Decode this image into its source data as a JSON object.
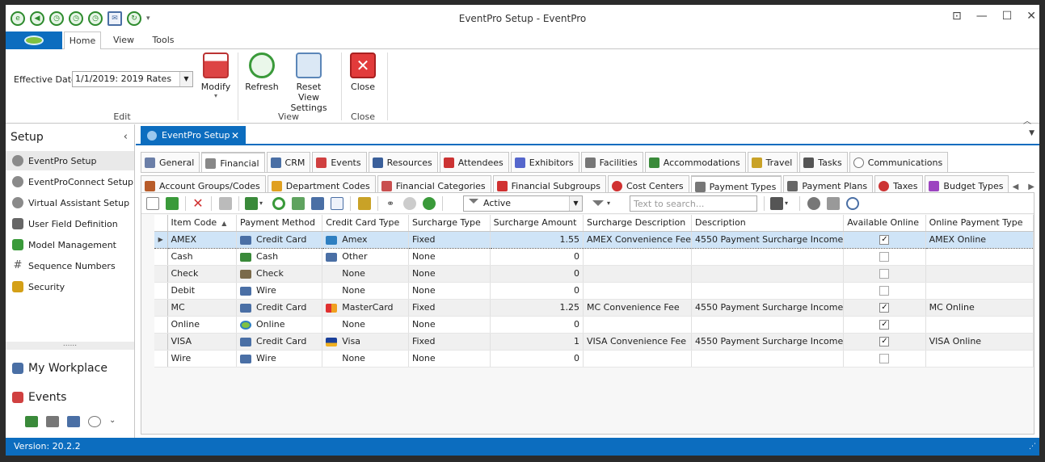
{
  "window": {
    "title": "EventPro Setup - EventPro"
  },
  "ribbon": {
    "tabs": [
      "Home",
      "View",
      "Tools"
    ],
    "effective_date_label": "Effective Date",
    "effective_date_value": "1/1/2019: 2019 Rates",
    "modify_label": "Modify",
    "refresh_label": "Refresh",
    "reset_label_1": "Reset View",
    "reset_label_2": "Settings",
    "close_label": "Close",
    "groups": [
      "Edit",
      "View",
      "Close"
    ]
  },
  "sidebar": {
    "title": "Setup",
    "items": [
      {
        "label": "EventPro Setup",
        "icon": "gears-icon",
        "color": "#7a7a7a"
      },
      {
        "label": "EventProConnect Setup",
        "icon": "gears-icon",
        "color": "#7a7a7a"
      },
      {
        "label": "Virtual Assistant Setup",
        "icon": "gears-icon",
        "color": "#7a7a7a"
      },
      {
        "label": "User Field Definition",
        "icon": "user-icon",
        "color": "#555555"
      },
      {
        "label": "Model Management",
        "icon": "model-icon",
        "color": "#3a9a3a"
      },
      {
        "label": "Sequence Numbers",
        "icon": "hash-icon",
        "color": "#555555"
      },
      {
        "label": "Security",
        "icon": "lock-icon",
        "color": "#d4a017"
      }
    ],
    "workplace_label": "My Workplace",
    "events_label": "Events"
  },
  "document_tab": {
    "label": "EventPro Setup",
    "close": "✕"
  },
  "main_tabs": [
    {
      "label": "General",
      "color": "#6b7fa8"
    },
    {
      "label": "Financial",
      "color": "#888888"
    },
    {
      "label": "CRM",
      "color": "#4a6fa5"
    },
    {
      "label": "Events",
      "color": "#d04040"
    },
    {
      "label": "Resources",
      "color": "#3a5f9a"
    },
    {
      "label": "Attendees",
      "color": "#cc3333"
    },
    {
      "label": "Exhibitors",
      "color": "#5566cc"
    },
    {
      "label": "Facilities",
      "color": "#777777"
    },
    {
      "label": "Accommodations",
      "color": "#3a8a3a"
    },
    {
      "label": "Travel",
      "color": "#c9a227"
    },
    {
      "label": "Tasks",
      "color": "#555555"
    },
    {
      "label": "Communications",
      "color": "#888888"
    }
  ],
  "sub_tabs": [
    {
      "label": "Account Groups/Codes",
      "color": "#b85c2a"
    },
    {
      "label": "Department Codes",
      "color": "#e0a020"
    },
    {
      "label": "Financial Categories",
      "color": "#c94f4f"
    },
    {
      "label": "Financial Subgroups",
      "color": "#d03030"
    },
    {
      "label": "Cost Centers",
      "color": "#d03030"
    },
    {
      "label": "Payment Types",
      "color": "#777777"
    },
    {
      "label": "Payment Plans",
      "color": "#666666"
    },
    {
      "label": "Taxes",
      "color": "#cc3333"
    },
    {
      "label": "Budget Types",
      "color": "#9c44c0"
    }
  ],
  "toolbar": {
    "filter_value": "Active",
    "search_placeholder": "Text to search..."
  },
  "grid": {
    "columns": [
      "Item Code",
      "Payment Method",
      "Credit Card Type",
      "Surcharge Type",
      "Surcharge Amount",
      "Surcharge Description",
      "Description",
      "Available Online",
      "Online Payment Type"
    ],
    "rows": [
      {
        "code": "AMEX",
        "method": "Credit Card",
        "card": "Amex",
        "stype": "Fixed",
        "amount": "1.55",
        "sdesc": "AMEX Convenience Fee",
        "desc": "4550 Payment Surcharge Income",
        "online": "✓",
        "otype": "AMEX Online"
      },
      {
        "code": "Cash",
        "method": "Cash",
        "card": "Other",
        "stype": "None",
        "amount": "0",
        "sdesc": "",
        "desc": "",
        "online": "",
        "otype": ""
      },
      {
        "code": "Check",
        "method": "Check",
        "card": "None",
        "stype": "None",
        "amount": "0",
        "sdesc": "",
        "desc": "",
        "online": "",
        "otype": ""
      },
      {
        "code": "Debit",
        "method": "Wire",
        "card": "None",
        "stype": "None",
        "amount": "0",
        "sdesc": "",
        "desc": "",
        "online": "",
        "otype": ""
      },
      {
        "code": "MC",
        "method": "Credit Card",
        "card": "MasterCard",
        "stype": "Fixed",
        "amount": "1.25",
        "sdesc": "MC Convenience Fee",
        "desc": "4550 Payment Surcharge Income",
        "online": "✓",
        "otype": "MC Online"
      },
      {
        "code": "Online",
        "method": "Online",
        "card": "None",
        "stype": "None",
        "amount": "0",
        "sdesc": "",
        "desc": "",
        "online": "✓",
        "otype": ""
      },
      {
        "code": "VISA",
        "method": "Credit Card",
        "card": "Visa",
        "stype": "Fixed",
        "amount": "1",
        "sdesc": "VISA Convenience Fee",
        "desc": "4550 Payment Surcharge Income",
        "online": "✓",
        "otype": "VISA Online"
      },
      {
        "code": "Wire",
        "method": "Wire",
        "card": "None",
        "stype": "None",
        "amount": "0",
        "sdesc": "",
        "desc": "",
        "online": "",
        "otype": ""
      }
    ],
    "record_count": "8"
  },
  "status": {
    "version": "Version: 20.2.2"
  },
  "colors": {
    "accent": "#0c6dbf",
    "selected_row": "#cfe4f7"
  }
}
